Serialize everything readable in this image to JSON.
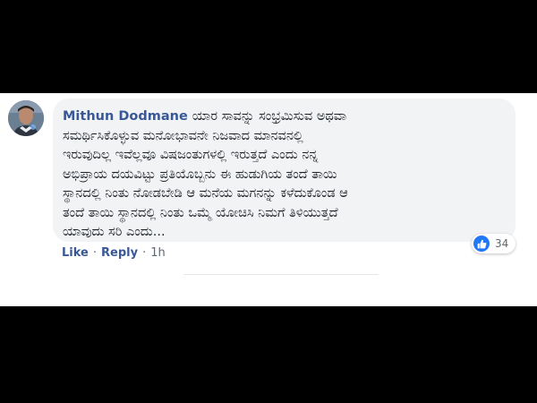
{
  "comment": {
    "author": "Mithun Dodmane",
    "text": "ಯಾರ ಸಾವನ್ನು ಸಂಭ್ರಮಿಸುವ ಅಥವಾ\nಸಮರ್ಥಿಸಿಕೊಳ್ಳುವ ಮನೋಭಾವನೇ ನಿಜವಾದ ಮಾನವನಲ್ಲಿ\nಇರುವುದಿಲ್ಲ ಇವೆಲ್ಲವೂ ವಿಷಜಂತುಗಳಲ್ಲಿ ಇರುತ್ತದೆ ಎಂದು ನನ್ನ\nಅಭಿಪ್ರಾಯ ದಯವಿಟ್ಟು ಪ್ರತಿಯೊಬ್ಬನು ಈ ಹುಡುಗಿಯ ತಂದೆ ತಾಯಿ\nಸ್ಥಾನದಲ್ಲಿ ನಿಂತು ನೋಡಬೇಡಿ ಆ ಮನೆಯ ಮಗನನ್ನು ಕಳೆದುಕೊಂಡ ಆ\nತಂದೆ ತಾಯಿ ಸ್ಥಾನದಲ್ಲಿ ನಿಂತು ಒಮ್ಮೆ ಯೋಚಿಸಿ ನಿಮಗೆ ತಿಳಿಯುತ್ತದೆ\nಯಾವುದು ಸರಿ ಎಂದು..."
  },
  "reactions": {
    "icon": "like-icon",
    "count": "34"
  },
  "actions": {
    "like_label": "Like",
    "reply_label": "Reply",
    "separator": "·",
    "timestamp": "1h"
  },
  "colors": {
    "author": "#385898",
    "bubble": "#f2f3f5",
    "like_badge": "#2078f4"
  }
}
